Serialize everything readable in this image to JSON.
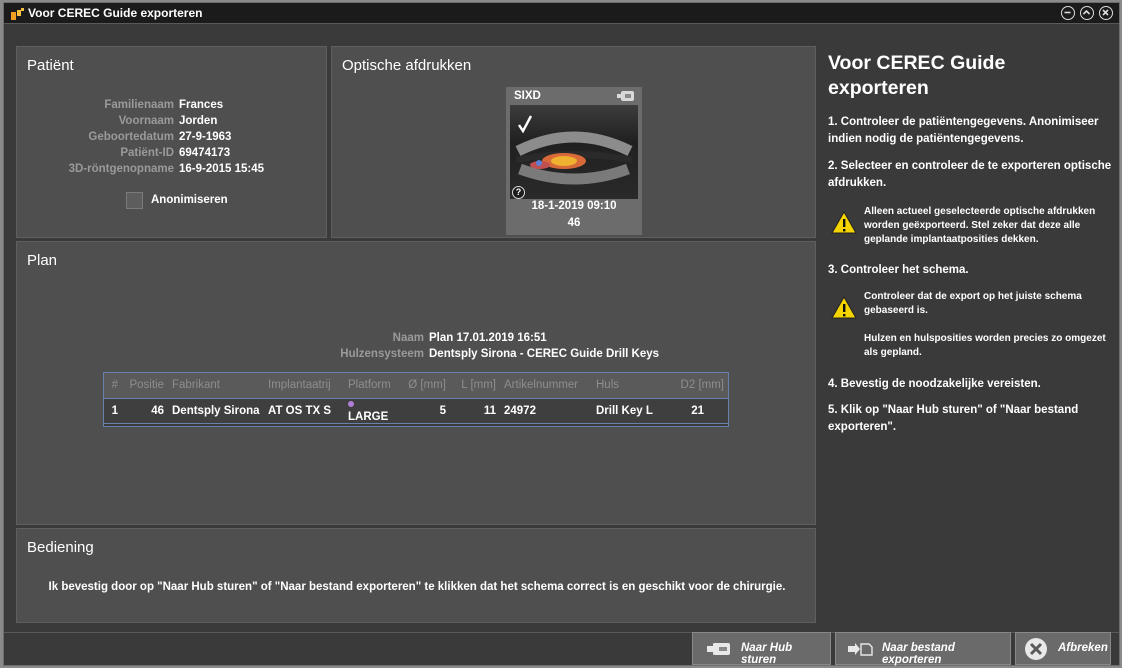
{
  "window": {
    "title": "Voor CEREC Guide exporteren"
  },
  "patient": {
    "title": "Patiënt",
    "fields": [
      {
        "label": "Familienaam",
        "value": "Frances"
      },
      {
        "label": "Voornaam",
        "value": "Jorden"
      },
      {
        "label": "Geboortedatum",
        "value": "27-9-1963"
      },
      {
        "label": "Patiënt-ID",
        "value": "69474173"
      },
      {
        "label": "3D-röntgenopname",
        "value": "16-9-2015 15:45"
      }
    ],
    "anonymize_label": "Anonimiseren",
    "anonymize_checked": false
  },
  "scans": {
    "title": "Optische afdrukken",
    "card": {
      "name": "SIXD",
      "checked": true,
      "date": "18-1-2019 09:10",
      "tooth": "46",
      "help": "?"
    }
  },
  "plan": {
    "title": "Plan",
    "name_label": "Naam",
    "name_value": "Plan 17.01.2019 16:51",
    "sleeve_label": "Hulzensysteem",
    "sleeve_value": "Dentsply Sirona - CEREC Guide Drill Keys",
    "columns": [
      "#",
      "Positie",
      "Fabrikant",
      "Implantaatrij",
      "Platform",
      "Ø [mm]",
      "L [mm]",
      "Artikelnummer",
      "Huls",
      "D2 [mm]"
    ],
    "rows": [
      {
        "num": "1",
        "pos": "46",
        "maker": "Dentsply Sirona",
        "line": "AT OS TX S",
        "platform": "LARGE",
        "platform_color": "#b07fd8",
        "dia": "5",
        "len": "11",
        "article": "24972",
        "sleeve": "Drill Key L",
        "d2": "21"
      }
    ]
  },
  "operation": {
    "title": "Bediening",
    "text": "Ik bevestig door op \"Naar Hub sturen\" of \"Naar bestand exporteren\" te klikken dat het schema correct is en geschikt voor de chirurgie."
  },
  "sidebar": {
    "title": "Voor CEREC Guide exporteren",
    "step1": "1. Controleer de patiëntengegevens. Anonimiseer indien nodig de patiëntengegevens.",
    "step2": "2. Selecteer en controleer de te exporteren optische afdrukken.",
    "warn1": "Alleen actueel geselecteerde optische afdrukken worden geëxporteerd. Stel zeker dat deze alle geplande implantaatposities dekken.",
    "step3": "3. Controleer het schema.",
    "warn2": "Controleer dat de export op het juiste schema gebaseerd is.",
    "note2": "Hulzen en hulsposities worden precies zo omgezet als gepland.",
    "step4": "4. Bevestig de noodzakelijke vereisten.",
    "step5": "5. Klik op \"Naar Hub sturen\" of \"Naar bestand exporteren\"."
  },
  "buttons": {
    "hub": "Naar Hub sturen",
    "file": "Naar bestand exporteren",
    "cancel": "Afbreken"
  },
  "colors": {
    "accent": "#6a7fae",
    "warning": "#f5d400"
  }
}
